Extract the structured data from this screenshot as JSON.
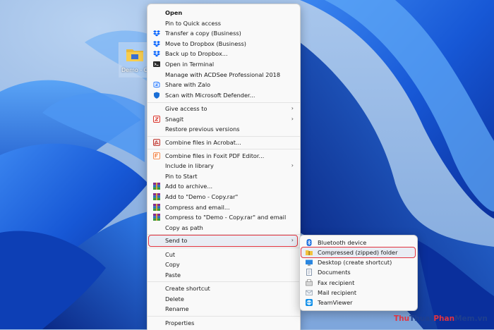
{
  "desktop": {
    "icon_label": "Demo - Co"
  },
  "context_menu": {
    "items": [
      {
        "label": "Open",
        "icon": "none",
        "bold": true
      },
      {
        "label": "Pin to Quick access",
        "icon": "none"
      },
      {
        "label": "Transfer a copy (Business)",
        "icon": "dropbox-icon"
      },
      {
        "label": "Move to Dropbox (Business)",
        "icon": "dropbox-icon"
      },
      {
        "label": "Back up to Dropbox...",
        "icon": "dropbox-icon"
      },
      {
        "label": "Open in Terminal",
        "icon": "terminal-icon"
      },
      {
        "label": "Manage with ACDSee Professional 2018",
        "icon": "none"
      },
      {
        "label": "Share with Zalo",
        "icon": "zalo-icon"
      },
      {
        "label": "Scan with Microsoft Defender...",
        "icon": "defender-shield-icon"
      },
      {
        "label": "Give access to",
        "icon": "none",
        "submenu": true
      },
      {
        "label": "Snagit",
        "icon": "snagit-icon",
        "submenu": true
      },
      {
        "label": "Restore previous versions",
        "icon": "none"
      },
      {
        "label": "Combine files in Acrobat...",
        "icon": "acrobat-icon"
      },
      {
        "label": "Combine files in Foxit PDF Editor...",
        "icon": "foxit-icon"
      },
      {
        "label": "Include in library",
        "icon": "none",
        "submenu": true
      },
      {
        "label": "Pin to Start",
        "icon": "none"
      },
      {
        "label": "Add to archive...",
        "icon": "winrar-icon"
      },
      {
        "label": "Add to \"Demo - Copy.rar\"",
        "icon": "winrar-icon"
      },
      {
        "label": "Compress and email...",
        "icon": "winrar-icon"
      },
      {
        "label": "Compress to \"Demo - Copy.rar\" and email",
        "icon": "winrar-icon"
      },
      {
        "label": "Copy as path",
        "icon": "none"
      },
      {
        "label": "Send to",
        "icon": "none",
        "submenu": true,
        "highlighted": true
      },
      {
        "label": "Cut",
        "icon": "none"
      },
      {
        "label": "Copy",
        "icon": "none"
      },
      {
        "label": "Paste",
        "icon": "none"
      },
      {
        "label": "Create shortcut",
        "icon": "none"
      },
      {
        "label": "Delete",
        "icon": "none"
      },
      {
        "label": "Rename",
        "icon": "none"
      },
      {
        "label": "Properties",
        "icon": "none"
      }
    ],
    "arrow": "›"
  },
  "send_to_menu": {
    "items": [
      {
        "label": "Bluetooth device",
        "icon": "bluetooth-icon"
      },
      {
        "label": "Compressed (zipped) folder",
        "icon": "zip-folder-icon",
        "highlighted": true
      },
      {
        "label": "Desktop (create shortcut)",
        "icon": "desktop-icon"
      },
      {
        "label": "Documents",
        "icon": "documents-icon"
      },
      {
        "label": "Fax recipient",
        "icon": "fax-icon"
      },
      {
        "label": "Mail recipient",
        "icon": "mail-icon"
      },
      {
        "label": "TeamViewer",
        "icon": "teamviewer-icon"
      }
    ]
  },
  "watermark": {
    "part1": "Thu",
    "part2": "Thuat",
    "part3": "Phan",
    "part4": "Mem",
    "part5": ".vn"
  },
  "colors": {
    "highlight_border": "#e2333f",
    "dropbox": "#0061fe",
    "wallpaper_blue": "#1a5bd8"
  }
}
